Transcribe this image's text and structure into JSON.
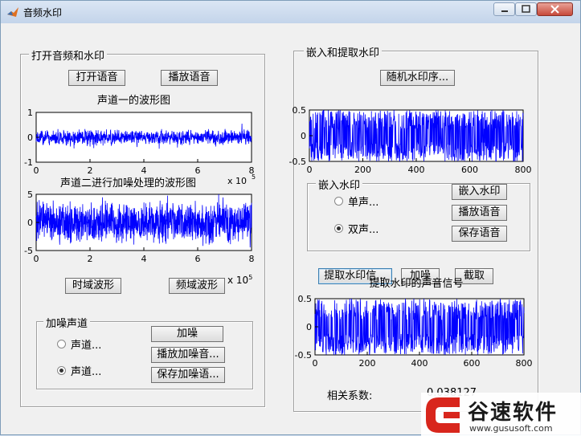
{
  "window": {
    "title": "音频水印"
  },
  "left_panel": {
    "title": "打开音频和水印",
    "open_button": "打开语音",
    "play_button": "播放语音",
    "time_button": "时域波形",
    "freq_button": "频域波形",
    "chart1": {
      "title": "声道一的波形图",
      "yticks": [
        "1",
        "0",
        "-1"
      ],
      "xticks": [
        "0",
        "2",
        "4",
        "6",
        "8"
      ],
      "exponent": "x 10",
      "exponent_power": "5"
    },
    "chart2": {
      "title": "声道二进行加噪处理的波形图",
      "yticks": [
        "5",
        "0",
        "-5"
      ],
      "xticks": [
        "0",
        "2",
        "4",
        "6",
        "8"
      ],
      "exponent": "x 10",
      "exponent_power": "5"
    },
    "noise_group": {
      "title": "加噪声道",
      "radio1": "声道...",
      "radio2": "声道...",
      "selected": 2,
      "add_noise_button": "加噪",
      "play_noise_button": "播放加噪音...",
      "save_noise_button": "保存加噪语..."
    }
  },
  "right_panel": {
    "title": "嵌入和提取水印",
    "random_button": "随机水印序...",
    "chart1": {
      "yticks": [
        "0.5",
        "0",
        "-0.5"
      ],
      "xticks": [
        "0",
        "200",
        "400",
        "600",
        "800"
      ]
    },
    "embed_group": {
      "title": "嵌入水印",
      "radio1": "单声...",
      "radio2": "双声...",
      "selected": 2,
      "embed_button": "嵌入水印",
      "play_button": "播放语音",
      "save_button": "保存语音"
    },
    "extract_button": "提取水印信...",
    "noise_button": "加噪",
    "crop_button": "截取",
    "chart2": {
      "title": "提取水印的声音信号",
      "yticks": [
        "0.5",
        "0",
        "-0.5"
      ],
      "xticks": [
        "0",
        "200",
        "400",
        "600",
        "800"
      ]
    },
    "corr_label": "相关系数:",
    "corr_value": "0.038127"
  },
  "watermark": {
    "brand": "谷速软件",
    "url": "www.gususoft.com"
  },
  "chart_data": [
    {
      "type": "line",
      "title": "声道一的波形图",
      "xlim": [
        0,
        800000
      ],
      "ylim": [
        -1,
        1
      ],
      "series_color": "#0000ff"
    },
    {
      "type": "line",
      "title": "声道二进行加噪处理的波形图",
      "xlim": [
        0,
        800000
      ],
      "ylim": [
        -5,
        5
      ],
      "series_color": "#0000ff"
    },
    {
      "type": "line",
      "xlim": [
        0,
        800
      ],
      "ylim": [
        -0.5,
        0.5
      ],
      "series_color": "#0000ff"
    },
    {
      "type": "line",
      "title": "提取水印的声音信号",
      "xlim": [
        0,
        800
      ],
      "ylim": [
        -0.5,
        0.5
      ],
      "series_color": "#0000ff"
    }
  ]
}
